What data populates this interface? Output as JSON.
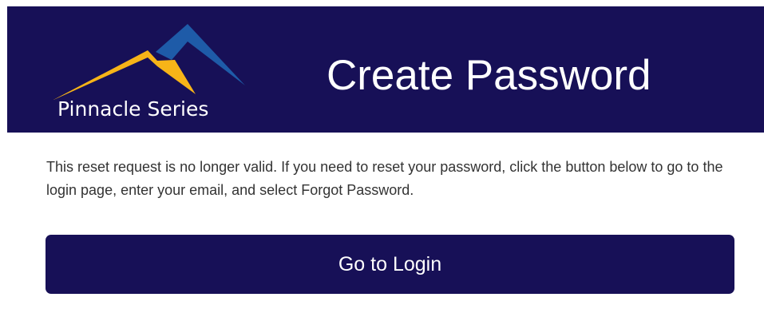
{
  "header": {
    "logo_text": "Pinnacle Series",
    "title": "Create Password"
  },
  "message": "This reset request is no longer valid. If you need to reset your password, click the button below to go to the login page, enter your email, and select Forgot Password.",
  "login_button": {
    "label": "Go to Login"
  },
  "colors": {
    "brand_navy": "#171057",
    "logo_gold": "#F7B418",
    "logo_blue": "#1E5BA8",
    "body_text": "#333333"
  }
}
